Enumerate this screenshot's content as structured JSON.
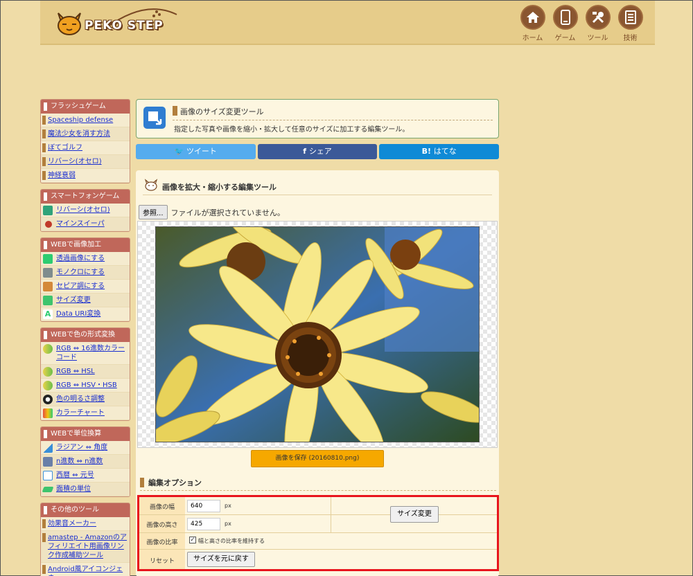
{
  "header": {
    "logo_text": "PEKO STEP",
    "nav": [
      {
        "label": "ホーム",
        "icon": "home-icon"
      },
      {
        "label": "ゲーム",
        "icon": "phone-icon"
      },
      {
        "label": "ツール",
        "icon": "tools-icon"
      },
      {
        "label": "技術",
        "icon": "document-icon"
      }
    ]
  },
  "sidebar": {
    "flash_games": {
      "title": "フラッシュゲーム",
      "items": [
        "Spaceship defense",
        "魔法少女を消す方法",
        "ぼてゴルフ",
        "リバーシ(オセロ)",
        "神経衰弱"
      ]
    },
    "smartphone_games": {
      "title": "スマートフォンゲーム",
      "items": [
        "リバーシ(オセロ)",
        "マインスイーパ"
      ]
    },
    "web_image": {
      "title": "WEBで画像加工",
      "items": [
        "透過画像にする",
        "モノクロにする",
        "セピア調にする",
        "サイズ変更",
        "Data URI変換"
      ]
    },
    "web_color": {
      "title": "WEBで色の形式変換",
      "items": [
        "RGB ⇔ 16進数カラーコード",
        "RGB ⇔ HSL",
        "RGB ⇔ HSV・HSB",
        "色の明るさ調整",
        "カラーチャート"
      ]
    },
    "web_unit": {
      "title": "WEBで単位換算",
      "items": [
        "ラジアン ⇔ 角度",
        "n進数 ⇔ n進数",
        "西暦 ⇔ 元号",
        "面積の単位"
      ]
    },
    "other_tools": {
      "title": "その他のツール",
      "items": [
        "効果音メーカー",
        "amastep - Amazonのアフィリエイト用画像リンク作成補助ツール",
        "Android風アイコンジェネ"
      ]
    }
  },
  "intro": {
    "title": "画像のサイズ変更ツール",
    "description": "指定した写真や画像を縮小・拡大して任意のサイズに加工する編集ツール。"
  },
  "share": {
    "twitter": "ツイート",
    "facebook": "シェア",
    "hatena": "はてな"
  },
  "panel": {
    "title": "画像を拡大・縮小する編集ツール",
    "file_button": "参照...",
    "file_status": "ファイルが選択されていません。",
    "save_button": "画像を保存 (20160810.png)"
  },
  "options": {
    "title": "編集オプション",
    "width_label": "画像の幅",
    "width_value": "640",
    "height_label": "画像の高さ",
    "height_value": "425",
    "unit": "px",
    "ratio_label": "画像の比率",
    "ratio_text": "幅と高さの比率を維持する",
    "ratio_checked": true,
    "reset_label": "リセット",
    "reset_button": "サイズを元に戻す",
    "apply_button": "サイズ変更"
  }
}
